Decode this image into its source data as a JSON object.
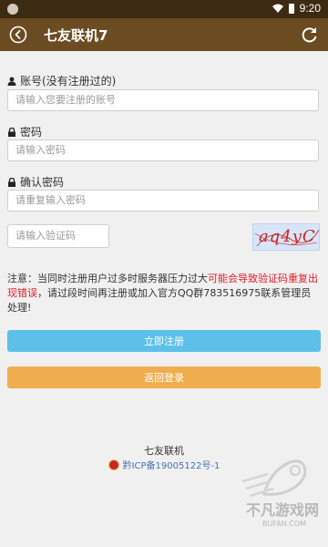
{
  "status_bar": {
    "time": "9:20"
  },
  "app_bar": {
    "title": "七友联机7"
  },
  "form": {
    "account_label": "账号(没有注册过的)",
    "account_placeholder": "请输入您要注册的账号",
    "password_label": "密码",
    "password_placeholder": "请输入密码",
    "confirm_label": "确认密码",
    "confirm_placeholder": "请重复输入密码",
    "captcha_placeholder": "请输入验证码",
    "captcha_text": "aq4yC"
  },
  "notice": {
    "prefix": "注意：当同时注册用户过多时服务器压力过大",
    "warning": "可能会导致验证码重复出现错误",
    "suffix": "，请过段时间再注册或加入官方QQ群783516975联系管理员处理!"
  },
  "buttons": {
    "register": "立即注册",
    "back_login": "返回登录"
  },
  "footer": {
    "name": "七友联机",
    "icp": "黔ICP备19005122号-1"
  },
  "watermark": {
    "text": "不凡游戏网",
    "url": "BUFAN.COM"
  },
  "colors": {
    "status_bar": "#3d2a12",
    "app_bar": "#6a4b22",
    "register_button": "#5cc0e8",
    "login_button": "#f0ad4e",
    "warning_text": "#e0202a"
  }
}
